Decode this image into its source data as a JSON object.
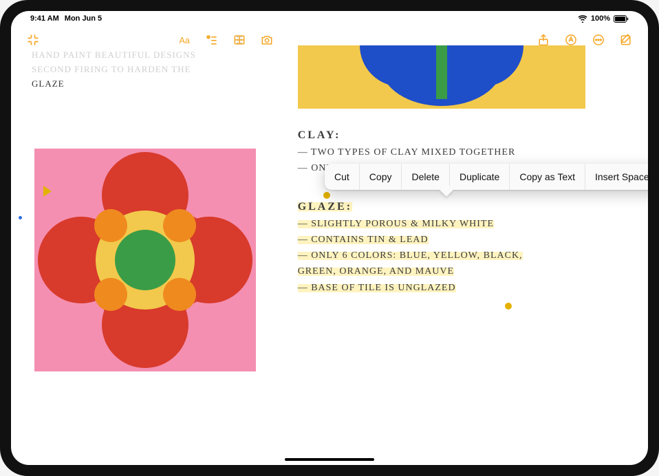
{
  "status": {
    "time": "9:41 AM",
    "date": "Mon Jun 5",
    "battery_pct": "100%"
  },
  "toolbar_icons": {
    "collapse": "collapse",
    "format": "Aa",
    "checklist": "checklist",
    "table": "table",
    "camera": "camera",
    "share": "share",
    "lock_circle": "lock",
    "more": "more",
    "compose": "compose",
    "grip": "⋮⋮"
  },
  "left_text": {
    "line1": "HAND PAINT BEAUTIFUL DESIGNS",
    "line2": "SECOND FIRING TO HARDEN THE",
    "line3": "GLAZE"
  },
  "clay": {
    "title": "CLAY:",
    "l1": "— TWO TYPES OF CLAY MIXED TOGETHER",
    "l2": "— ONLY NATURAL CLAYS"
  },
  "glaze": {
    "title": "GLAZE:",
    "l1": "— SLIGHTLY POROUS & MILKY WHITE",
    "l2": "— CONTAINS TIN & LEAD",
    "l3": "— ONLY 6 COLORS: BLUE, YELLOW, BLACK,",
    "l3b": "   GREEN, ORANGE, AND MAUVE",
    "l4": "— BASE OF TILE IS UNGLAZED"
  },
  "callout": {
    "cut": "Cut",
    "copy": "Copy",
    "delete": "Delete",
    "duplicate": "Duplicate",
    "copy_as_text": "Copy as Text",
    "insert_space": "Insert Space Above"
  },
  "colors": {
    "accent": "#f5a623",
    "highlight": "#fff3bf",
    "pink": "#f48fb1",
    "yellow": "#f2c94c",
    "blue": "#1f4ec9",
    "green": "#2e8b3d",
    "red": "#d83a2b",
    "orange": "#ef8a1f"
  }
}
